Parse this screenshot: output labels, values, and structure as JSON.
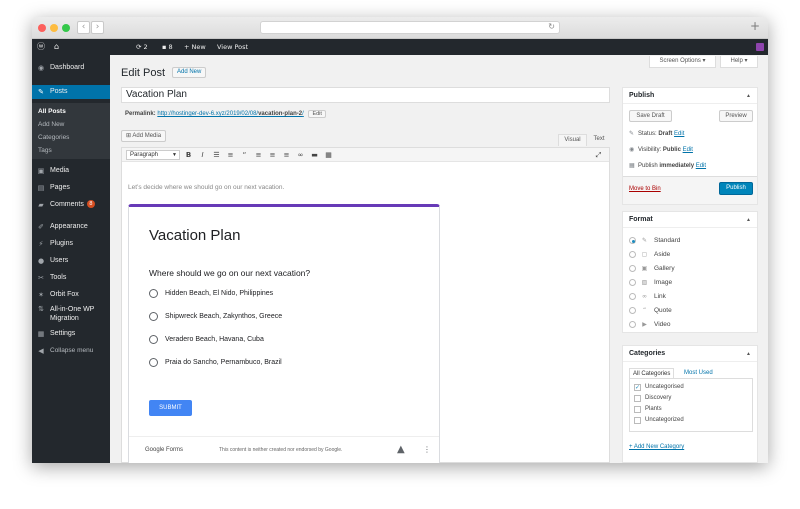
{
  "browser": {
    "back_glyph": "‹",
    "forward_glyph": "›",
    "reload_glyph": "↻",
    "new_tab_glyph": "+"
  },
  "adminbar": {
    "updates_count": "2",
    "comments_count": "8",
    "new_label": "New",
    "view_post_label": "View Post"
  },
  "sidebar": {
    "items": [
      {
        "icon": "dashboard-icon",
        "label": "Dashboard"
      },
      {
        "icon": "posts-icon",
        "label": "Posts"
      },
      {
        "icon": "media-icon",
        "label": "Media"
      },
      {
        "icon": "pages-icon",
        "label": "Pages"
      },
      {
        "icon": "comments-icon",
        "label": "Comments",
        "badge": "8"
      },
      {
        "icon": "appearance-icon",
        "label": "Appearance"
      },
      {
        "icon": "plugins-icon",
        "label": "Plugins"
      },
      {
        "icon": "users-icon",
        "label": "Users"
      },
      {
        "icon": "tools-icon",
        "label": "Tools"
      },
      {
        "icon": "orbit-fox-icon",
        "label": "Orbit Fox"
      },
      {
        "icon": "migration-icon",
        "label": "All-in-One WP Migration"
      },
      {
        "icon": "settings-icon",
        "label": "Settings"
      },
      {
        "icon": "collapse-icon",
        "label": "Collapse menu"
      }
    ],
    "submenu": [
      "All Posts",
      "Add New",
      "Categories",
      "Tags"
    ]
  },
  "header": {
    "title": "Edit Post",
    "add_new": "Add New",
    "screen_options": "Screen Options ▾",
    "help": "Help ▾"
  },
  "post": {
    "title": "Vacation Plan",
    "permalink_label": "Permalink:",
    "permalink_base": "http://hostinger-dev-6.xyz/2019/02/08/",
    "permalink_slug": "vacation-plan-2",
    "permalink_end": "/",
    "edit_label": "Edit"
  },
  "editor": {
    "add_media": "Add Media",
    "tab_visual": "Visual",
    "tab_text": "Text",
    "format_select": "Paragraph",
    "intro_text": "Let’s decide where we should go on our next vacation."
  },
  "form": {
    "title": "Vacation Plan",
    "question": "Where should we go on our next vacation?",
    "options": [
      "Hidden Beach, El Nido, Philippines",
      "Shipwreck Beach, Zakynthos, Greece",
      "Veradero Beach, Havana, Cuba",
      "Praia do Sancho, Pernambuco, Brazil"
    ],
    "submit": "SUBMIT",
    "brand": "Google Forms",
    "disclaimer": "This content is neither created nor endorsed by Google.",
    "accent": "#673ab7"
  },
  "publish": {
    "heading": "Publish",
    "save_draft": "Save Draft",
    "preview": "Preview",
    "status_label": "Status:",
    "status_value": "Draft",
    "visibility_label": "Visibility:",
    "visibility_value": "Public",
    "publish_label": "Publish",
    "publish_value": "immediately",
    "edit_link": "Edit",
    "trash": "Move to Bin",
    "publish_button": "Publish"
  },
  "format": {
    "heading": "Format",
    "options": [
      {
        "icon": "pin-icon",
        "label": "Standard",
        "selected": true
      },
      {
        "icon": "aside-icon",
        "label": "Aside"
      },
      {
        "icon": "gallery-icon",
        "label": "Gallery"
      },
      {
        "icon": "image-icon",
        "label": "Image"
      },
      {
        "icon": "link-icon",
        "label": "Link"
      },
      {
        "icon": "quote-icon",
        "label": "Quote"
      },
      {
        "icon": "video-icon",
        "label": "Video"
      }
    ]
  },
  "categories": {
    "heading": "Categories",
    "tab_all": "All Categories",
    "tab_used": "Most Used",
    "items": [
      {
        "label": "Uncategorised",
        "checked": true
      },
      {
        "label": "Discovery",
        "checked": false
      },
      {
        "label": "Plants",
        "checked": false
      },
      {
        "label": "Uncategorized",
        "checked": false
      }
    ],
    "add_new": "+ Add New Category"
  },
  "colors": {
    "admin_dark": "#23282d",
    "active_blue": "#0073aa",
    "primary_button": "#0085ba",
    "submit_blue": "#4285f4"
  }
}
